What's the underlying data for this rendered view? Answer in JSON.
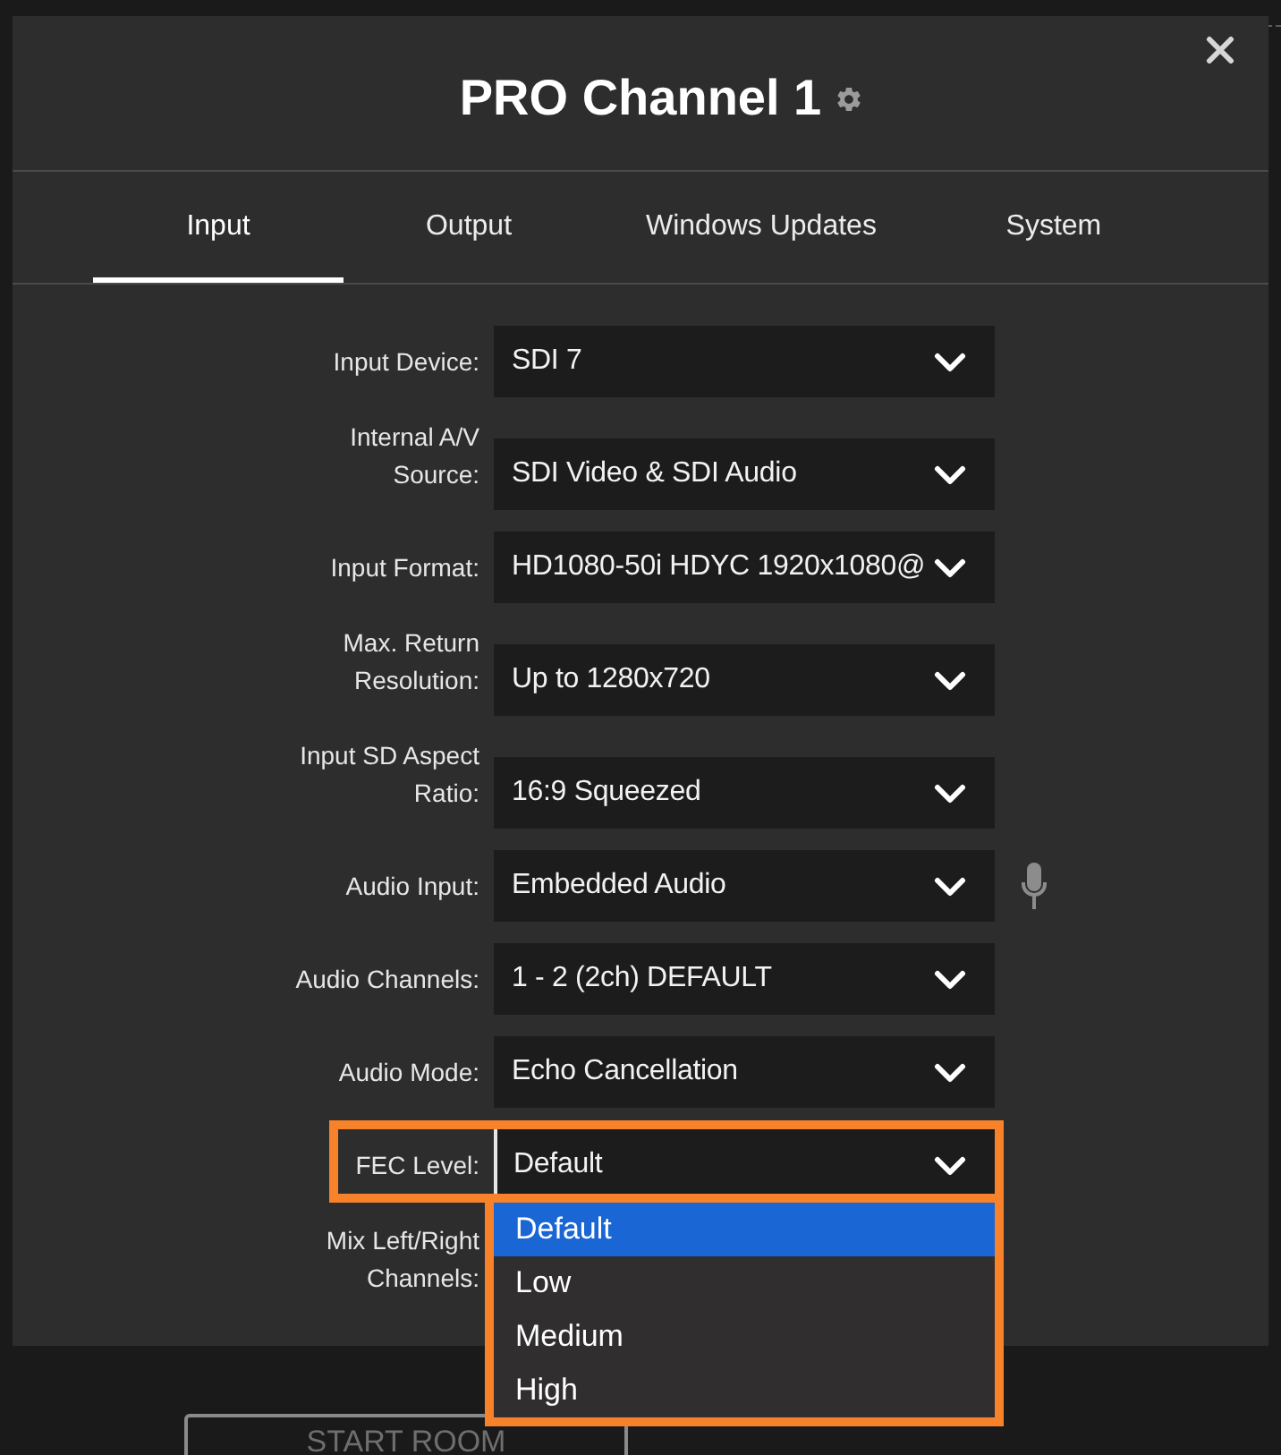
{
  "dialog": {
    "title": "PRO Channel 1"
  },
  "tabs": [
    {
      "label": "Input",
      "selected": true
    },
    {
      "label": "Output",
      "selected": false
    },
    {
      "label": "Windows Updates",
      "selected": false
    },
    {
      "label": "System",
      "selected": false
    }
  ],
  "fields": [
    {
      "label": "Input Device:",
      "value": "SDI 7",
      "expanded": false
    },
    {
      "label": "Internal A/V Source:",
      "value": "SDI Video & SDI Audio",
      "expanded": false
    },
    {
      "label": "Input Format:",
      "value": "HD1080-50i HDYC 1920x1080@",
      "expanded": false
    },
    {
      "label": "Max. Return Resolution:",
      "value": "Up to 1280x720",
      "expanded": false
    },
    {
      "label": "Input SD Aspect Ratio:",
      "value": "16:9 Squeezed",
      "expanded": false
    },
    {
      "label": "Audio Input:",
      "value": "Embedded Audio",
      "expanded": false,
      "side_button": true
    },
    {
      "label": "Audio Channels:",
      "value": "1 - 2 (2ch) DEFAULT",
      "expanded": false
    },
    {
      "label": "Audio Mode:",
      "value": "Echo Cancellation",
      "expanded": false
    },
    {
      "label": "FEC Level:",
      "value": "Default",
      "expanded": true,
      "highlighted": true,
      "options": [
        {
          "label": "Default",
          "selected": true
        },
        {
          "label": "Low",
          "selected": false
        },
        {
          "label": "Medium",
          "selected": false
        },
        {
          "label": "High",
          "selected": false
        }
      ]
    },
    {
      "label": "Mix Left/Right Channels:"
    }
  ],
  "page": {
    "start_button": "START ROOM"
  }
}
